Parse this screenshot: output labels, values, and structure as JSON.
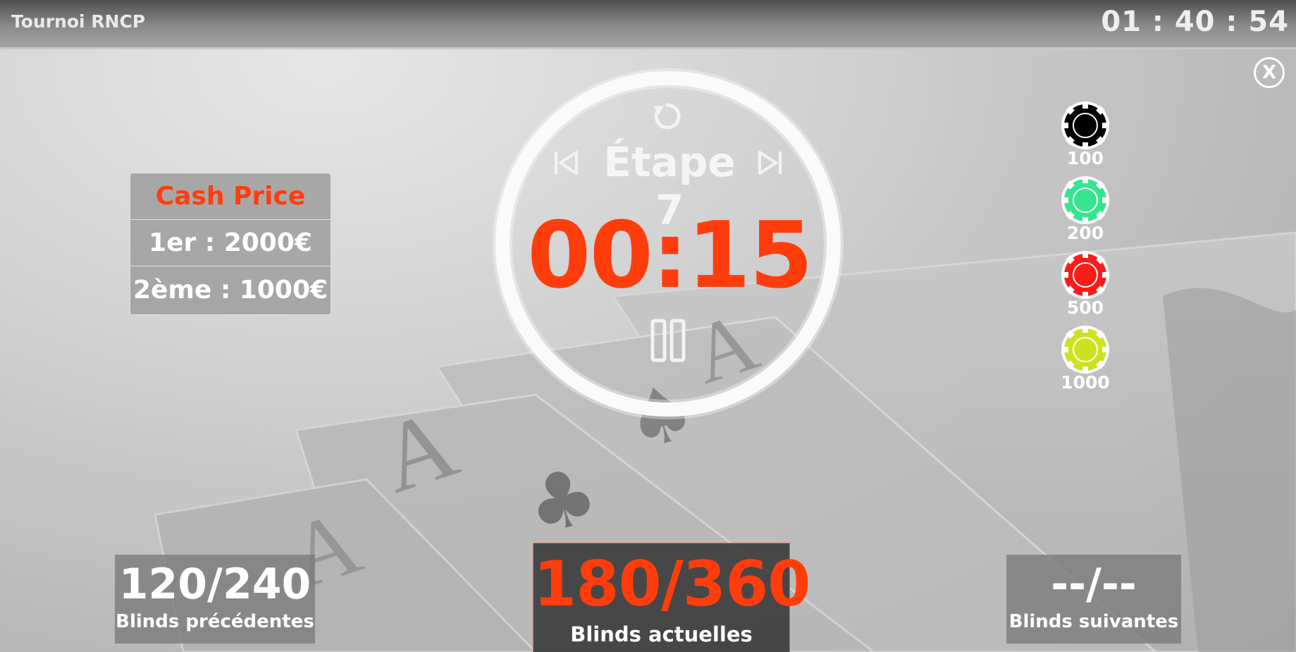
{
  "app": {
    "title": "Tournoi RNCP",
    "clock": "01 : 40 : 54"
  },
  "close_label": "X",
  "cash_price": {
    "title": "Cash Price",
    "rows": [
      "1er : 2000€",
      "2ème : 1000€"
    ]
  },
  "timer": {
    "stage": "Étape 7",
    "countdown": "00:15",
    "ring_color": "#fafafa",
    "accent": "#ff3d0c"
  },
  "chips": [
    {
      "value": "100",
      "color": "#000000"
    },
    {
      "value": "200",
      "color": "#35e58f"
    },
    {
      "value": "500",
      "color": "#ff1a1a"
    },
    {
      "value": "1000",
      "color": "#cde21f"
    }
  ],
  "blinds": {
    "previous": {
      "value": "120/240",
      "label": "Blinds précédentes"
    },
    "current": {
      "value": "180/360",
      "label": "Blinds actuelles"
    },
    "next": {
      "value": "--/--",
      "label": "Blinds suivantes"
    }
  },
  "icons": [
    "reset-icon",
    "previous-icon",
    "next-icon",
    "pause-icon",
    "close-icon"
  ]
}
